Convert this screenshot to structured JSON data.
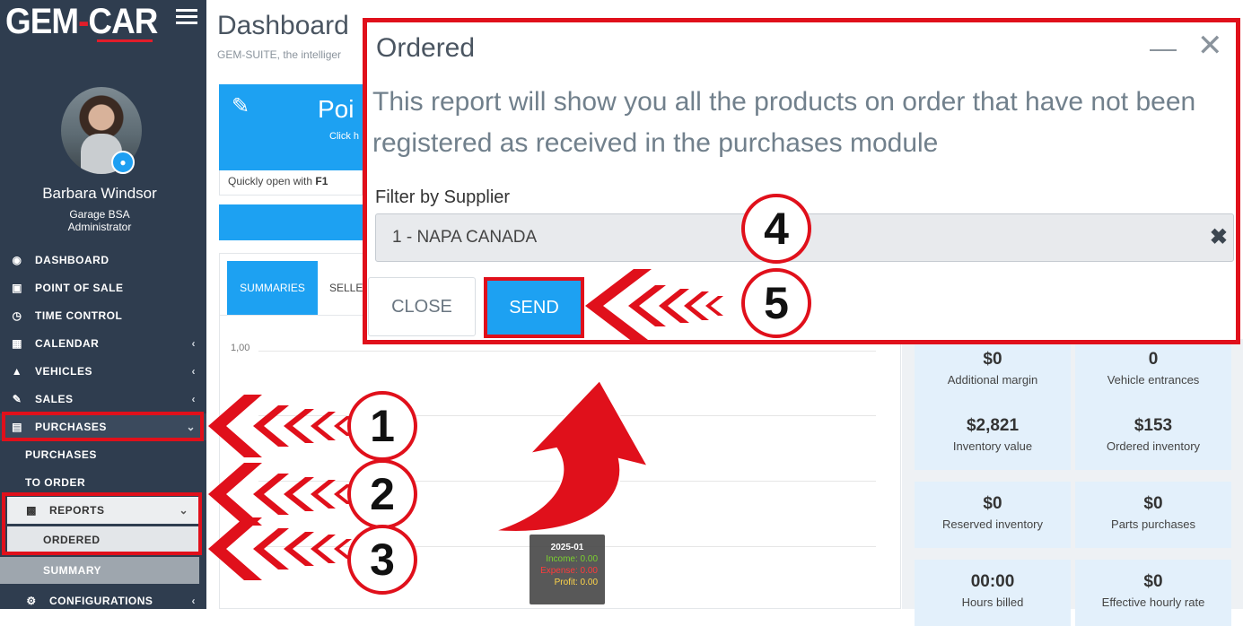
{
  "sidebar": {
    "logo_left": "GEM",
    "logo_dash": "-",
    "logo_right": "CAR",
    "user_name": "Barbara Windsor",
    "user_garage": "Garage BSA",
    "user_role": "Administrator",
    "nav": {
      "dashboard": "DASHBOARD",
      "point_of_sale": "POINT OF SALE",
      "time_control": "TIME CONTROL",
      "calendar": "CALENDAR",
      "vehicles": "VEHICLES",
      "sales": "SALES",
      "purchases": "PURCHASES",
      "sub_purchases": "PURCHASES",
      "to_order": "TO ORDER",
      "reports": "REPORTS",
      "ordered": "ORDERED",
      "summary": "SUMMARY",
      "configurations": "CONFIGURATIONS"
    }
  },
  "main": {
    "title": "Dashboard",
    "subtitle": "GEM-SUITE, the intelliger",
    "pos_card_title": "Poi",
    "pos_card_sub": "Click h",
    "quick_open_text": "Quickly open with ",
    "quick_open_key": "F1",
    "tab_summaries": "SUMMARIES",
    "tab_sellers": "SELLE",
    "y_tick_top": "1,00",
    "tooltip": {
      "period": "2025-01",
      "income": "Income: 0.00",
      "expense": "Expense: 0.00",
      "profit": "Profit: 0.00"
    },
    "stats": [
      {
        "value": "$0",
        "label": "Additional margin"
      },
      {
        "value": "0",
        "label": "Vehicle entrances"
      },
      {
        "value": "$2,821",
        "label": "Inventory value"
      },
      {
        "value": "$153",
        "label": "Ordered inventory"
      },
      {
        "value": "$0",
        "label": "Reserved inventory"
      },
      {
        "value": "$0",
        "label": "Parts purchases"
      },
      {
        "value": "00:00",
        "label": "Hours billed"
      },
      {
        "value": "$0",
        "label": "Effective hourly rate"
      }
    ]
  },
  "modal": {
    "title": "Ordered",
    "description": "This report will show you all the products on order that have not been registered as received in the purchases module",
    "filter_label": "Filter by Supplier",
    "filter_value": "1 - NAPA CANADA",
    "close_label": "CLOSE",
    "send_label": "SEND"
  },
  "annotations": {
    "step1": "1",
    "step2": "2",
    "step3": "3",
    "step4": "4",
    "step5": "5",
    "highlight_color": "#e0101b"
  },
  "colors": {
    "sidebar_bg": "#2f3d4f",
    "accent_blue": "#1da1f2",
    "brand_red": "#e11d2a"
  }
}
